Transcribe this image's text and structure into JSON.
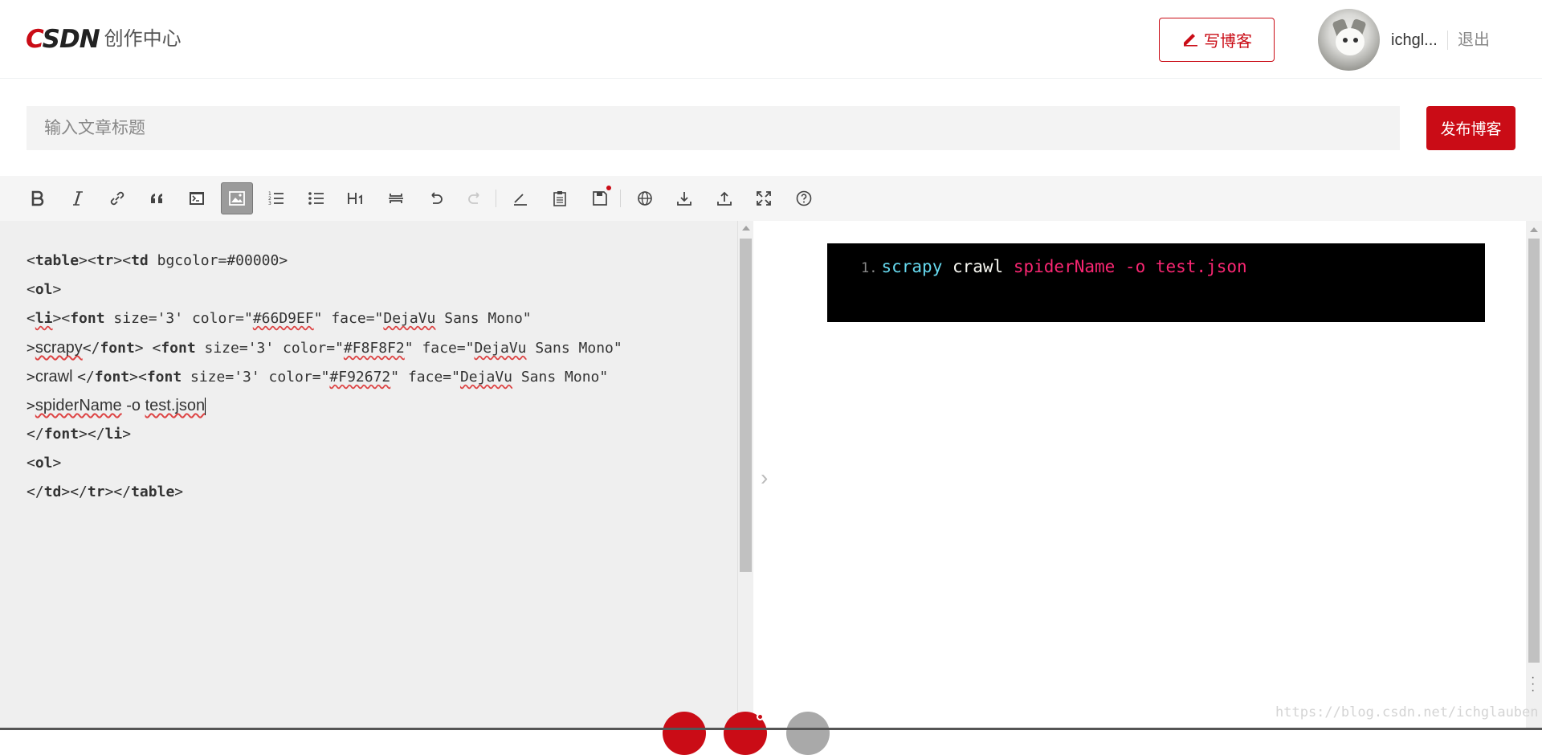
{
  "header": {
    "logo_text": "CSDN",
    "logo_subtitle": "创作中心",
    "write_button": "写博客",
    "username": "ichgl...",
    "logout": "退出"
  },
  "title_bar": {
    "placeholder": "输入文章标题",
    "value": "",
    "publish_button": "发布博客"
  },
  "toolbar": {
    "buttons": [
      {
        "name": "bold-icon"
      },
      {
        "name": "italic-icon"
      },
      {
        "name": "link-icon"
      },
      {
        "name": "quote-icon"
      },
      {
        "name": "code-icon"
      },
      {
        "name": "image-icon",
        "active": true
      },
      {
        "name": "ordered-list-icon"
      },
      {
        "name": "unordered-list-icon"
      },
      {
        "name": "heading-icon"
      },
      {
        "name": "horizontal-rule-icon"
      },
      {
        "name": "undo-icon"
      },
      {
        "name": "redo-icon"
      },
      {
        "name": "pen-icon"
      },
      {
        "name": "clipboard-icon"
      },
      {
        "name": "save-icon",
        "notification": true
      },
      {
        "name": "globe-icon"
      },
      {
        "name": "download-icon"
      },
      {
        "name": "upload-icon"
      },
      {
        "name": "fullscreen-icon"
      },
      {
        "name": "help-icon"
      }
    ]
  },
  "editor": {
    "lines": [
      "<table><tr><td bgcolor=#00000>",
      "<ol>",
      "<li><font size='3' color=\"#66D9EF\" face=\"DejaVu Sans Mono\"",
      ">scrapy</font> <font size='3' color=\"#F8F8F2\" face=\"DejaVu Sans Mono\"",
      ">crawl </font><font size='3' color=\"#F92672\" face=\"DejaVu Sans Mono\"",
      ">spiderName -o test.json",
      "</font></li>",
      "<ol>",
      "</td></tr></table>"
    ]
  },
  "preview": {
    "line_number": "1.",
    "tokens": [
      {
        "text": "scrapy",
        "color": "#66D9EF"
      },
      {
        "text": " crawl ",
        "color": "#F8F8F2"
      },
      {
        "text": "spiderName -o test.json",
        "color": "#F92672"
      }
    ],
    "code_background": "#000000"
  },
  "watermark": "https://blog.csdn.net/ichglauben",
  "colors": {
    "brand": "#CA0C16"
  }
}
